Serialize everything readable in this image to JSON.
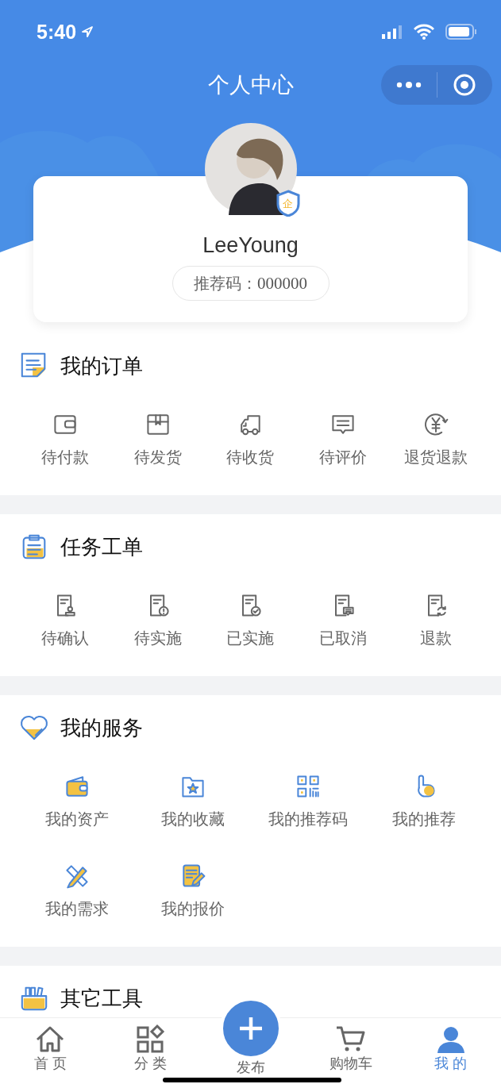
{
  "status_bar": {
    "time": "5:40"
  },
  "header": {
    "title": "个人中心"
  },
  "profile": {
    "badge": "企",
    "name": "LeeYoung",
    "referral_label": "推荐码：",
    "referral_code": "000000"
  },
  "sections": [
    {
      "title": "我的订单",
      "kind": "row",
      "items": [
        {
          "label": "待付款"
        },
        {
          "label": "待发货"
        },
        {
          "label": "待收货"
        },
        {
          "label": "待评价"
        },
        {
          "label": "退货退款"
        }
      ]
    },
    {
      "title": "任务工单",
      "kind": "row",
      "items": [
        {
          "label": "待确认"
        },
        {
          "label": "待实施"
        },
        {
          "label": "已实施"
        },
        {
          "label": "已取消"
        },
        {
          "label": "退款"
        }
      ]
    },
    {
      "title": "我的服务",
      "kind": "grid",
      "items": [
        {
          "label": "我的资产"
        },
        {
          "label": "我的收藏"
        },
        {
          "label": "我的推荐码"
        },
        {
          "label": "我的推荐"
        },
        {
          "label": "我的需求"
        },
        {
          "label": "我的报价"
        }
      ]
    },
    {
      "title": "其它工具"
    }
  ],
  "tab_bar": [
    {
      "label": "首 页",
      "selected": false,
      "kind": "tab"
    },
    {
      "label": "分 类",
      "selected": false,
      "kind": "tab"
    },
    {
      "label": "发布",
      "selected": false,
      "kind": "action"
    },
    {
      "label": "购物车",
      "selected": false,
      "kind": "tab"
    },
    {
      "label": "我 的",
      "selected": true,
      "kind": "tab"
    }
  ]
}
